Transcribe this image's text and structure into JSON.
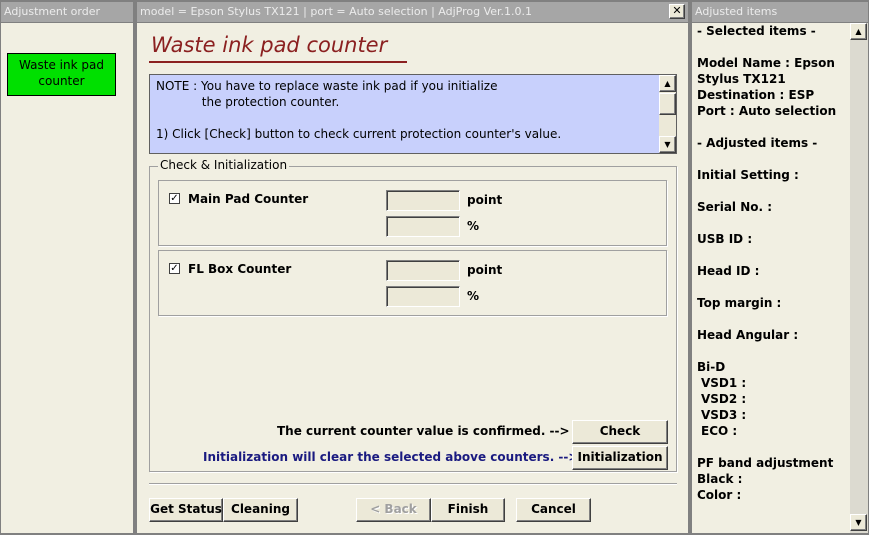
{
  "left_panel": {
    "title": "Adjustment order",
    "items": [
      {
        "label_line1": "Waste ink pad",
        "label_line2": "counter"
      }
    ]
  },
  "header": {
    "title": "model = Epson Stylus TX121  |  port = Auto selection  |  AdjProg Ver.1.0.1",
    "close_glyph": "✕"
  },
  "main": {
    "page_title": "Waste ink pad counter",
    "note": {
      "line1": "NOTE : You have to replace waste ink pad if you initialize",
      "line2": "            the protection counter.",
      "line3": "",
      "line4": "1) Click [Check] button to check current protection counter's value."
    },
    "group_label": "Check & Initialization",
    "counters": [
      {
        "label": "Main Pad Counter",
        "checked": true,
        "unit_point": "point",
        "unit_percent": "%",
        "point_value": "",
        "percent_value": ""
      },
      {
        "label": "FL Box Counter",
        "checked": true,
        "unit_point": "point",
        "unit_percent": "%",
        "point_value": "",
        "percent_value": ""
      }
    ],
    "confirm_text": "The current counter value is confirmed. -->",
    "init_text": "Initialization will clear the selected above counters. -->",
    "check_button": "Check",
    "init_button": "Initialization",
    "check_mark": "✓"
  },
  "footer_buttons": {
    "get_status": "Get Status",
    "cleaning": "Cleaning",
    "back": "< Back",
    "finish": "Finish",
    "cancel": "Cancel"
  },
  "right_panel": {
    "title": "Adjusted items",
    "selected_header": "- Selected items -",
    "model_name_line1": "Model Name : Epson",
    "model_name_line2": "Stylus TX121",
    "destination": "Destination : ESP",
    "port": "Port : Auto selection",
    "adjusted_header": "- Adjusted items -",
    "initial_setting": "Initial Setting :",
    "serial_no": "Serial No. :",
    "usb_id": "USB ID :",
    "head_id": "Head ID :",
    "top_margin": "Top margin :",
    "head_angular": "Head Angular :",
    "bid": "Bi-D",
    "vsd1": "VSD1 :",
    "vsd2": "VSD2 :",
    "vsd3": "VSD3 :",
    "eco": "ECO  :",
    "pf_band": "PF band adjustment",
    "black": "Black :",
    "color": "Color :"
  },
  "scroll_glyphs": {
    "up": "▲",
    "down": "▼"
  },
  "colors": {
    "accent_title": "#8b2020",
    "note_bg": "#c8d0fc",
    "selected_item": "#00e000",
    "init_text": "#1a1a80"
  }
}
